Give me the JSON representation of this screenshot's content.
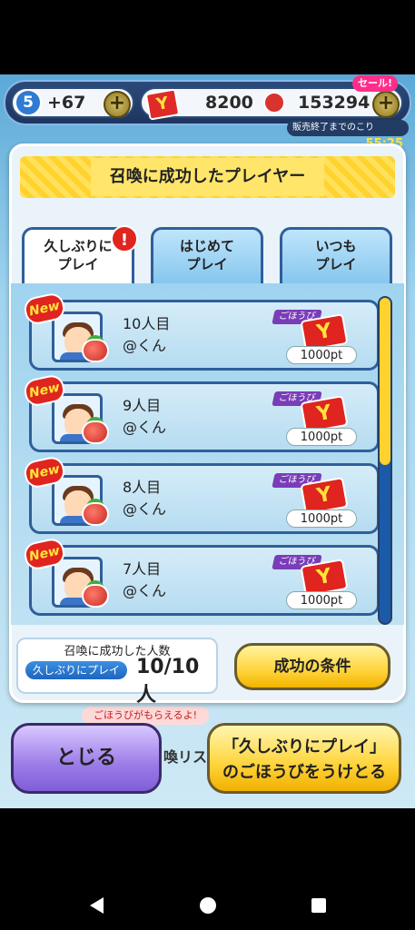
{
  "resources": {
    "level": "5",
    "stamina": "+67",
    "points": "8200",
    "coins": "153294",
    "sale_badge": "セール!",
    "timer_label": "販売終了までのこり",
    "timer_value": "55:25",
    "plus": "+"
  },
  "panel": {
    "title": "召喚に成功したプレイヤー",
    "tabs": [
      {
        "line1": "久しぶりに",
        "line2": "プレイ"
      },
      {
        "line1": "はじめて",
        "line2": "プレイ"
      },
      {
        "line1": "いつも",
        "line2": "プレイ"
      }
    ],
    "alert": "!"
  },
  "rows": [
    {
      "badge": "New",
      "name": "10人目",
      "user": "@くん",
      "reward_label": "ごほうび",
      "reward": "1000pt"
    },
    {
      "badge": "New",
      "name": "9人目",
      "user": "@くん",
      "reward_label": "ごほうび",
      "reward": "1000pt"
    },
    {
      "badge": "New",
      "name": "8人目",
      "user": "@くん",
      "reward_label": "ごほうび",
      "reward": "1000pt"
    },
    {
      "badge": "New",
      "name": "7人目",
      "user": "@くん",
      "reward_label": "ごほうび",
      "reward": "1000pt"
    }
  ],
  "summary": {
    "label": "召喚に成功した人数",
    "category": "久しぶりにプレイ",
    "count": "10/10人",
    "conditions_button": "成功の条件"
  },
  "background": {
    "banner": "ごほうびがもらえるよ!",
    "list_text": "喚リス"
  },
  "buttons": {
    "close": "とじる",
    "claim_line1": "「久しぶりにプレイ」",
    "claim_line2": "のごほうびをうけとる"
  }
}
